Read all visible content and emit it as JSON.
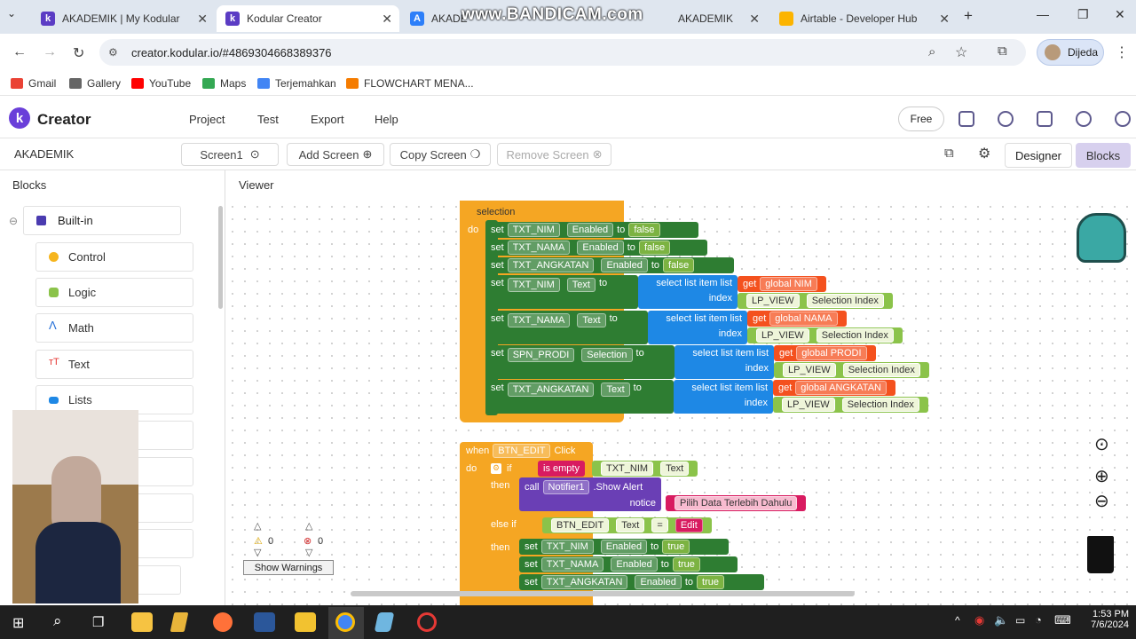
{
  "browser": {
    "tabs": [
      {
        "title": "AKADEMIK | My Kodular"
      },
      {
        "title": "Kodular Creator"
      },
      {
        "title": "AKADE"
      },
      {
        "title": "AKADEMIK"
      },
      {
        "title": "Airtable - Developer Hub"
      }
    ],
    "watermark": "www.BANDICAM.com",
    "url": "creator.kodular.io/#4869304668389376",
    "profile": "Dijeda",
    "bookmarks": [
      "Gmail",
      "Gallery",
      "YouTube",
      "Maps",
      "Terjemahkan",
      "FLOWCHART MENA..."
    ]
  },
  "app": {
    "title": "Creator",
    "logo_letter": "k",
    "menu": [
      "Project",
      "Test",
      "Export",
      "Help"
    ],
    "free_label": "Free",
    "project": "AKADEMIK",
    "screen": "Screen1",
    "add_screen": "Add Screen",
    "copy_screen": "Copy Screen",
    "remove_screen": "Remove Screen",
    "designer": "Designer",
    "blocks": "Blocks"
  },
  "left_panel": {
    "header": "Blocks",
    "builtin": "Built-in",
    "categories": [
      {
        "label": "Control",
        "color": "#f6b51e"
      },
      {
        "label": "Logic",
        "color": "#8bc34a"
      },
      {
        "label": "Math",
        "color": "#1e88e5"
      },
      {
        "label": "Text",
        "color": "#e53935"
      },
      {
        "label": "Lists",
        "color": "#1e88e5"
      }
    ]
  },
  "viewer": {
    "header": "Viewer",
    "warnings": "0",
    "errors": "0",
    "show_warnings": "Show Warnings",
    "event1": {
      "label": "selection",
      "do": "do",
      "rows": [
        {
          "set": "set",
          "comp": "TXT_NIM",
          "prop": "Enabled",
          "to": "to",
          "val": "false"
        },
        {
          "set": "set",
          "comp": "TXT_NAMA",
          "prop": "Enabled",
          "to": "to",
          "val": "false"
        },
        {
          "set": "set",
          "comp": "TXT_ANGKATAN",
          "prop": "Enabled",
          "to": "to",
          "val": "false"
        }
      ],
      "sel_rows": [
        {
          "set": "set",
          "comp": "TXT_NIM",
          "prop": "Text",
          "to": "to",
          "select": "select list item  list",
          "get": "get",
          "global": "global NIM",
          "index": "index",
          "lp": "LP_VIEW",
          "selidx": "Selection Index"
        },
        {
          "set": "set",
          "comp": "TXT_NAMA",
          "prop": "Text",
          "to": "to",
          "select": "select list item  list",
          "get": "get",
          "global": "global NAMA",
          "index": "index",
          "lp": "LP_VIEW",
          "selidx": "Selection Index"
        },
        {
          "set": "set",
          "comp": "SPN_PRODI",
          "prop": "Selection",
          "to": "to",
          "select": "select list item  list",
          "get": "get",
          "global": "global PRODI",
          "index": "index",
          "lp": "LP_VIEW",
          "selidx": "Selection Index"
        },
        {
          "set": "set",
          "comp": "TXT_ANGKATAN",
          "prop": "Text",
          "to": "to",
          "select": "select list item  list",
          "get": "get",
          "global": "global ANGKATAN",
          "index": "index",
          "lp": "LP_VIEW",
          "selidx": "Selection Index"
        }
      ]
    },
    "event2": {
      "when": "when",
      "comp": "BTN_EDIT",
      "evt": "Click",
      "do": "do",
      "if": "if",
      "is_empty": "is empty",
      "txt_nim": "TXT_NIM",
      "text": "Text",
      "then": "then",
      "call": "call",
      "notifier": "Notifier1",
      "show_alert": ".Show Alert",
      "notice": "notice",
      "message": "Pilih Data Terlebih Dahulu",
      "else_if": "else if",
      "btn_edit": "BTN_EDIT",
      "eq": "=",
      "edit": "Edit",
      "then2": "then",
      "rows": [
        {
          "set": "set",
          "comp": "TXT_NIM",
          "prop": "Enabled",
          "to": "to",
          "val": "true"
        },
        {
          "set": "set",
          "comp": "TXT_NAMA",
          "prop": "Enabled",
          "to": "to",
          "val": "true"
        },
        {
          "set": "set",
          "comp": "TXT_ANGKATAN",
          "prop": "Enabled",
          "to": "to",
          "val": "true"
        }
      ]
    }
  },
  "taskbar": {
    "time": "1:53 PM",
    "date": "7/6/2024"
  }
}
